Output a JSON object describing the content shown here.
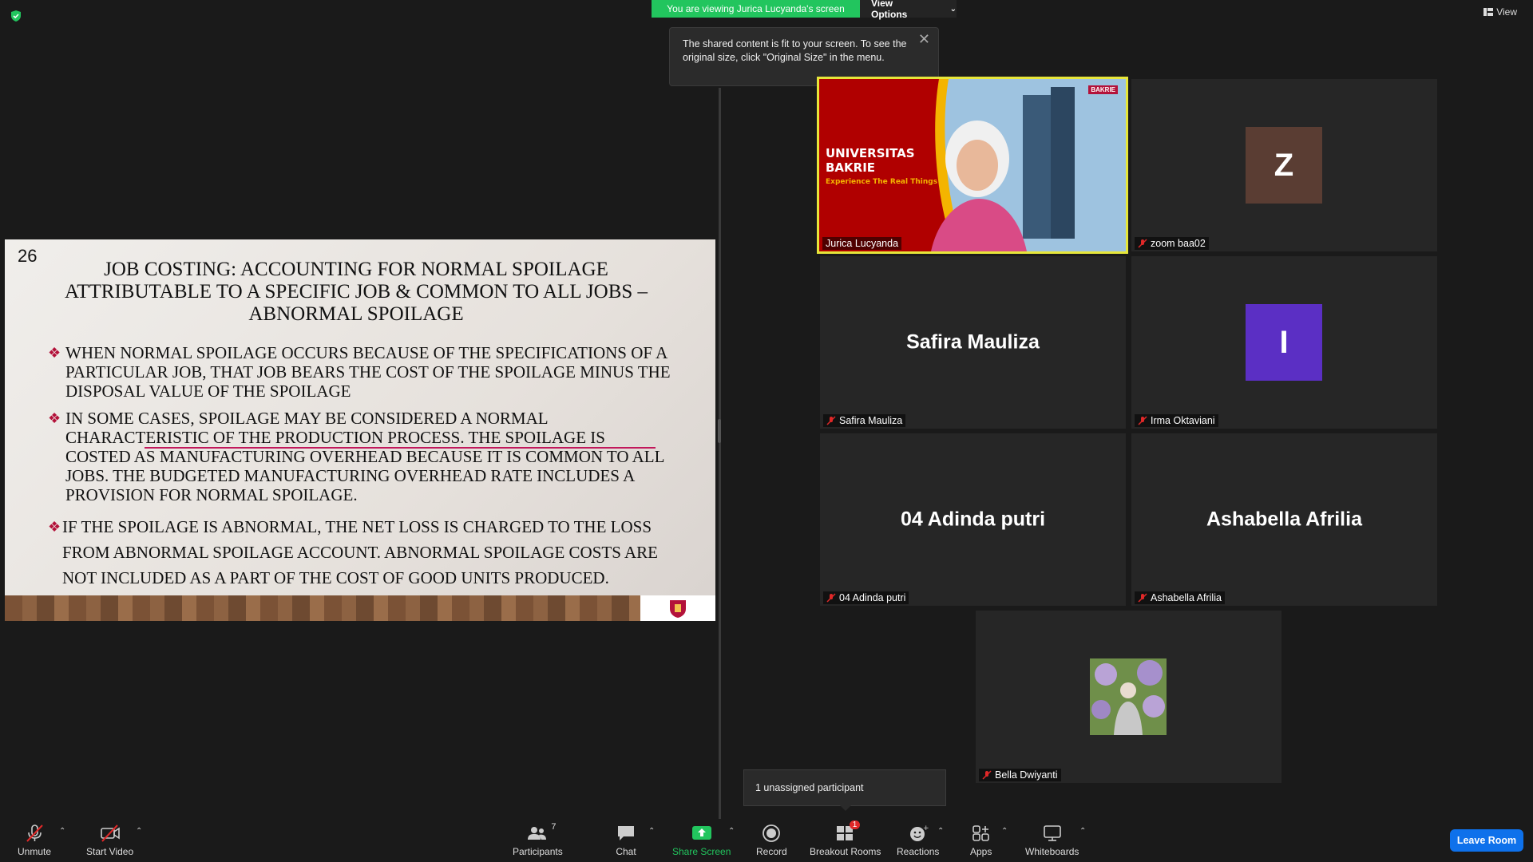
{
  "topbar": {
    "viewing_banner": "You are viewing Jurica Lucyanda's screen",
    "view_options_label": "View Options",
    "view_label": "View"
  },
  "tooltip": {
    "text": "The shared content is fit to your screen. To see the original size, click \"Original Size\" in the menu."
  },
  "slide": {
    "number": "26",
    "title": "Job Costing: Accounting for Normal Spoilage Attributable to a Specific Job & Common to All Jobs – Abnormal Spoilage",
    "bullets": [
      "WHEN NORMAL SPOILAGE OCCURS BECAUSE OF THE SPECIFICATIONS OF A PARTICULAR JOB, THAT JOB BEARS THE COST OF THE SPOILAGE MINUS THE DISPOSAL VALUE OF THE SPOILAGE",
      "IN SOME CASES, SPOILAGE MAY BE CONSIDERED A NORMAL CHARACTERISTIC OF THE PRODUCTION PROCESS.  THE SPOILAGE IS COSTED AS MANUFACTURING OVERHEAD BECAUSE IT IS COMMON TO ALL JOBS. THE BUDGETED MANUFACTURING OVERHEAD RATE INCLUDES A PROVISION FOR NORMAL SPOILAGE.",
      "IF THE SPOILAGE IS ABNORMAL, THE NET LOSS IS CHARGED TO THE LOSS FROM ABNORMAL SPOILAGE ACCOUNT. ABNORMAL SPOILAGE COSTS ARE NOT INCLUDED AS A PART OF THE COST OF GOOD UNITS PRODUCED."
    ]
  },
  "gallery": {
    "jurica": {
      "name": "Jurica Lucyanda",
      "bg_title_1": "UNIVERSITAS",
      "bg_title_2": "BAKRIE",
      "bg_tagline": "Experience The Real Things",
      "logo_text": "BAKRIE"
    },
    "zoom": {
      "name": "zoom baa02",
      "initial": "Z",
      "color": "#5a3d33"
    },
    "safira": {
      "name": "Safira Mauliza",
      "display": "Safira Mauliza"
    },
    "irma": {
      "name": "Irma Oktaviani",
      "initial": "I",
      "color": "#5b2fc4"
    },
    "adinda": {
      "name": "04 Adinda putri",
      "display": "04 Adinda putri"
    },
    "ashabella": {
      "name": "Ashabella Afrilia",
      "display": "Ashabella Afrilia"
    },
    "bella": {
      "name": "Bella Dwiyanti"
    }
  },
  "unassigned": {
    "text": "1 unassigned participant"
  },
  "toolbar": {
    "unmute": "Unmute",
    "start_video": "Start Video",
    "participants": "Participants",
    "participants_count": "7",
    "chat": "Chat",
    "share_screen": "Share Screen",
    "record": "Record",
    "breakout_rooms": "Breakout Rooms",
    "breakout_badge": "1",
    "reactions": "Reactions",
    "apps": "Apps",
    "whiteboards": "Whiteboards",
    "leave_room": "Leave Room"
  },
  "colors": {
    "green": "#22c55e",
    "accent_blue": "#0e71eb",
    "speaker_border": "#e6e63a",
    "mic_red": "#e02828"
  }
}
